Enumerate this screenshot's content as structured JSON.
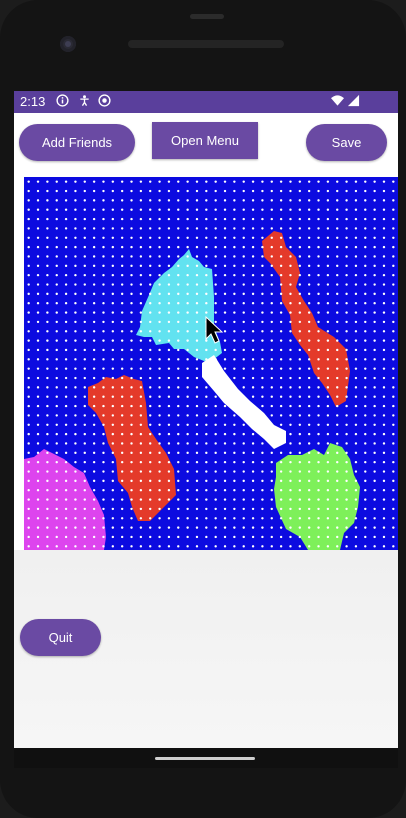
{
  "status_bar": {
    "time": "2:13",
    "left_icons": [
      "info-icon",
      "accessibility-icon",
      "notification-icon"
    ],
    "right_icons": [
      "wifi-icon",
      "signal-icon"
    ],
    "color": "#5a3f9c"
  },
  "toolbar": {
    "add_friends_label": "Add Friends",
    "open_menu_label": "Open Menu",
    "save_label": "Save"
  },
  "bottom": {
    "quit_label": "Quit"
  },
  "pixel_grid": {
    "description_colors": {
      "background": "#0c0be0",
      "dot": "#ffffff",
      "cyan": "#62e2f0",
      "red": "#e43a2a",
      "white": "#ffffff",
      "magenta": "#dd44ee",
      "green": "#7ef05a"
    },
    "cols": 40,
    "rows": 40
  },
  "colors": {
    "accent": "#6a4aa3"
  }
}
